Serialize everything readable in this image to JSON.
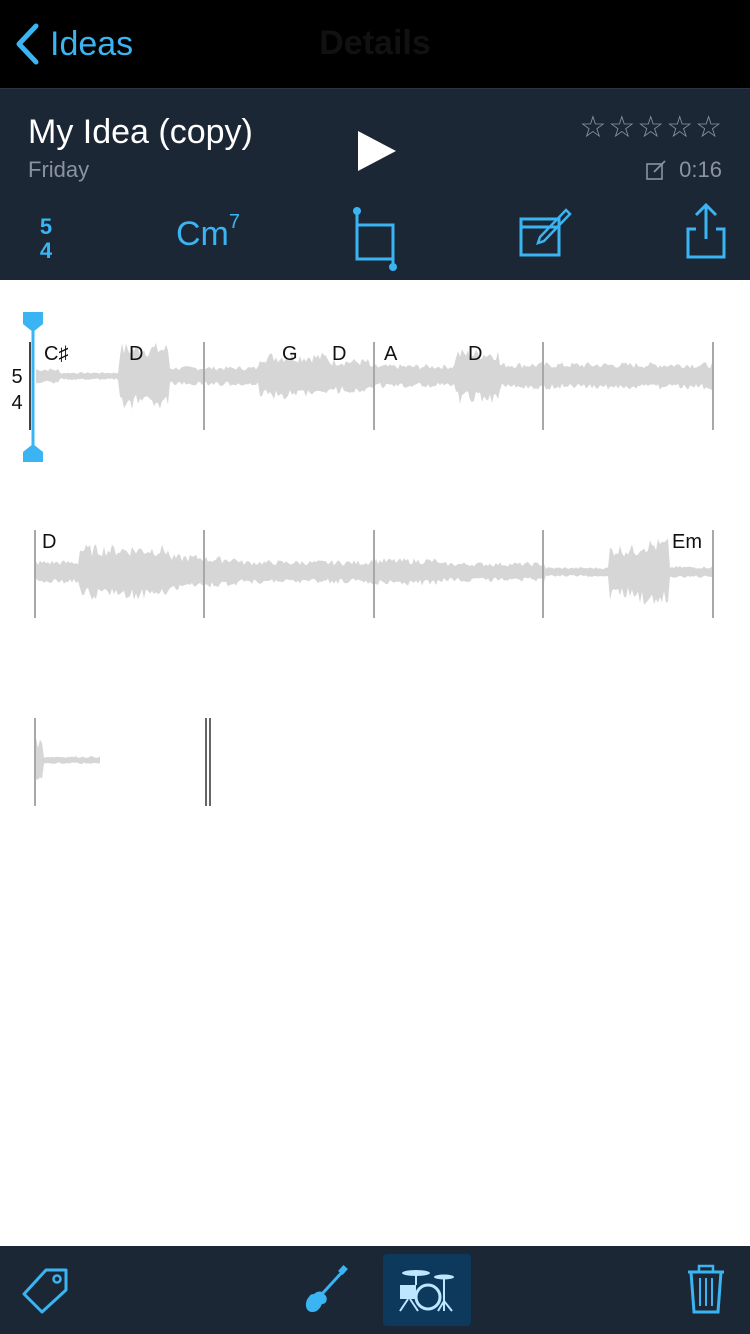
{
  "navbar": {
    "back_label": "Ideas",
    "title": "Details"
  },
  "idea": {
    "title": "My Idea (copy)",
    "date": "Friday",
    "duration": "0:16",
    "rating": 0,
    "max_rating": 5
  },
  "toolbar": {
    "time_sig_top": "5",
    "time_sig_bottom": "4",
    "chord_root": "Cm",
    "chord_ext": "7"
  },
  "rows": [
    {
      "chords": [
        "C♯",
        "D",
        "G",
        "D",
        "A",
        "D"
      ]
    },
    {
      "chords": [
        "D",
        "Em"
      ]
    },
    {
      "chords": []
    }
  ],
  "timesig_side": {
    "top": "5",
    "bottom": "4"
  },
  "colors": {
    "accent": "#3ab4f2",
    "bar_bg": "#1c2735",
    "wave": "#d6d6d6"
  },
  "icons": {
    "back": "chevron-left-icon",
    "play": "play-icon",
    "crop": "crop-icon",
    "edit": "edit-icon",
    "share": "share-icon",
    "tag": "tag-icon",
    "guitar": "guitar-icon",
    "drums": "drums-icon",
    "trash": "trash-icon"
  }
}
